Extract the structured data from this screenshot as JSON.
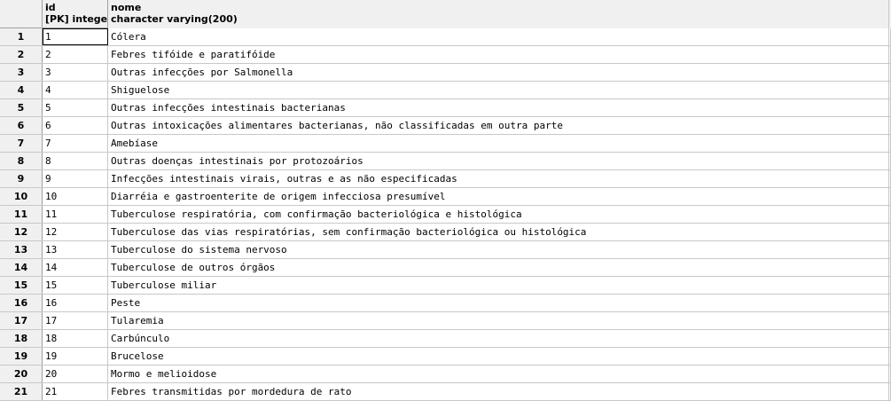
{
  "columns": [
    {
      "name": "id",
      "type": "[PK] integer"
    },
    {
      "name": "nome",
      "type": "character varying(200)"
    }
  ],
  "rows": [
    {
      "n": "1",
      "id": "1",
      "nome": "Cólera"
    },
    {
      "n": "2",
      "id": "2",
      "nome": "Febres tifóide e paratifóide"
    },
    {
      "n": "3",
      "id": "3",
      "nome": "Outras infecções por Salmonella"
    },
    {
      "n": "4",
      "id": "4",
      "nome": "Shiguelose"
    },
    {
      "n": "5",
      "id": "5",
      "nome": "Outras infecções intestinais bacterianas"
    },
    {
      "n": "6",
      "id": "6",
      "nome": "Outras intoxicações alimentares bacterianas, não classificadas em outra parte"
    },
    {
      "n": "7",
      "id": "7",
      "nome": "Amebíase"
    },
    {
      "n": "8",
      "id": "8",
      "nome": "Outras doenças intestinais por protozoários"
    },
    {
      "n": "9",
      "id": "9",
      "nome": "Infecções intestinais virais, outras e as não especificadas"
    },
    {
      "n": "10",
      "id": "10",
      "nome": "Diarréia e gastroenterite de origem infecciosa presumível"
    },
    {
      "n": "11",
      "id": "11",
      "nome": "Tuberculose respiratória, com confirmação bacteriológica e histológica"
    },
    {
      "n": "12",
      "id": "12",
      "nome": "Tuberculose das vias respiratórias, sem confirmação bacteriológica ou histológica"
    },
    {
      "n": "13",
      "id": "13",
      "nome": "Tuberculose do sistema nervoso"
    },
    {
      "n": "14",
      "id": "14",
      "nome": "Tuberculose de outros órgãos"
    },
    {
      "n": "15",
      "id": "15",
      "nome": "Tuberculose miliar"
    },
    {
      "n": "16",
      "id": "16",
      "nome": "Peste"
    },
    {
      "n": "17",
      "id": "17",
      "nome": "Tularemia"
    },
    {
      "n": "18",
      "id": "18",
      "nome": "Carbúnculo"
    },
    {
      "n": "19",
      "id": "19",
      "nome": "Brucelose"
    },
    {
      "n": "20",
      "id": "20",
      "nome": "Mormo e melioidose"
    },
    {
      "n": "21",
      "id": "21",
      "nome": "Febres transmitidas por mordedura de rato"
    }
  ]
}
